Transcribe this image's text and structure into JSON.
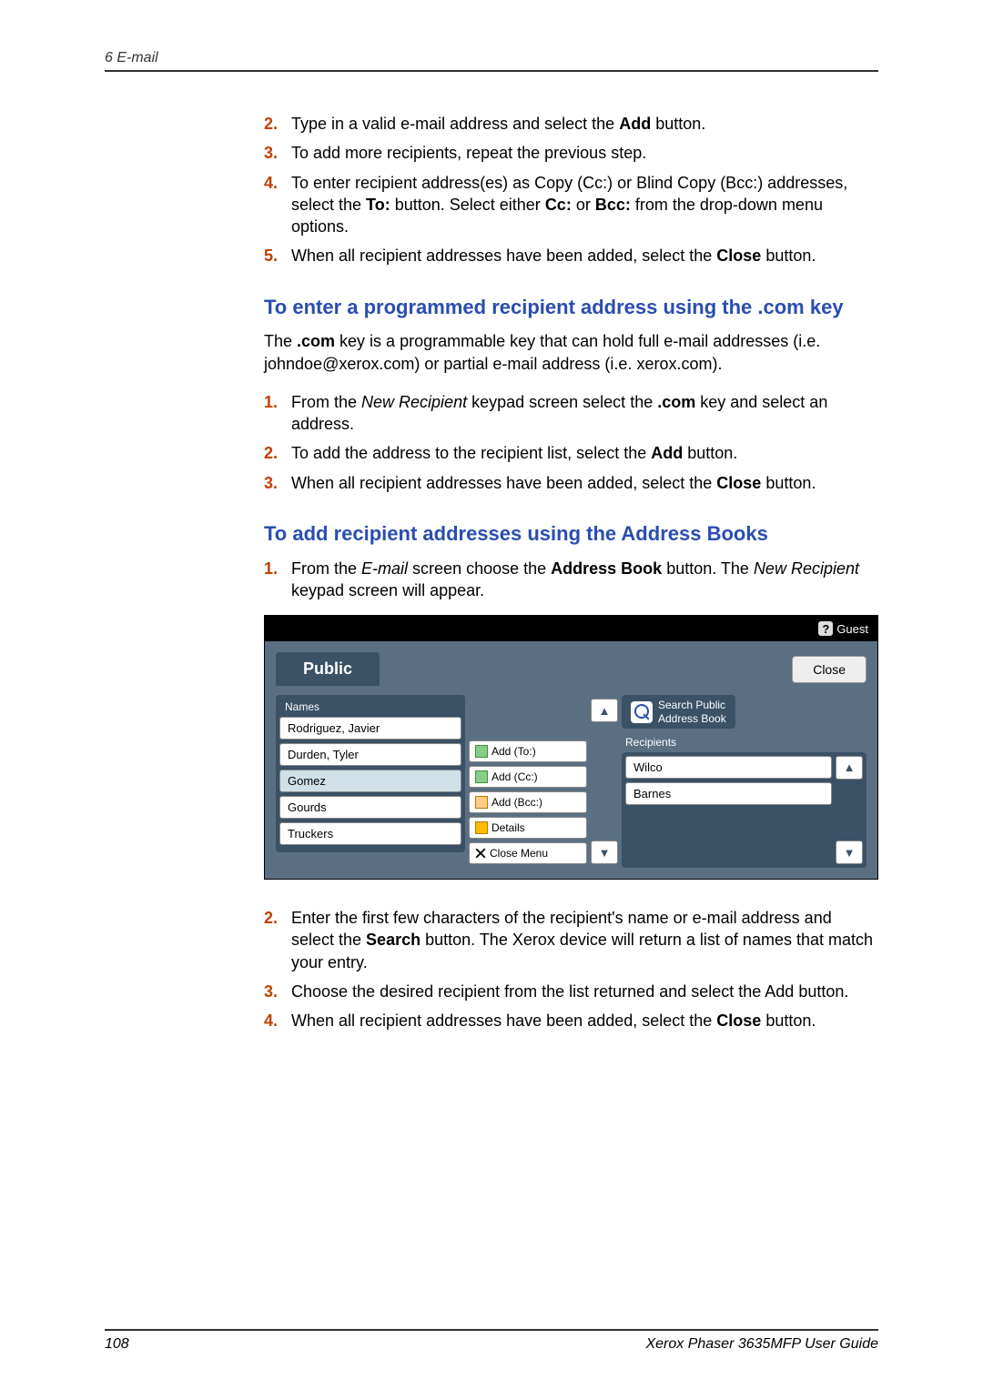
{
  "header": {
    "chapter": "6   E-mail"
  },
  "listA": {
    "n2": "2.",
    "t2a": "Type in a valid e-mail address and select the ",
    "t2b": "Add",
    "t2c": " button.",
    "n3": "3.",
    "t3": "To add more recipients, repeat the previous step.",
    "n4": "4.",
    "t4a": "To enter recipient address(es) as Copy (Cc:) or Blind Copy (Bcc:) addresses, select the ",
    "t4b": "To:",
    "t4c": " button. Select either ",
    "t4d": "Cc:",
    "t4e": " or ",
    "t4f": "Bcc:",
    "t4g": " from the drop-down menu options.",
    "n5": "5.",
    "t5a": "When all recipient addresses have been added, select the ",
    "t5b": "Close",
    "t5c": " button."
  },
  "h1": "To enter a programmed recipient address using the .com key",
  "p1": {
    "a": "The ",
    "b": ".com",
    "c": " key is a programmable key that can hold full e-mail addresses (i.e. johndoe@xerox.com) or partial e-mail address (i.e. xerox.com)."
  },
  "listB": {
    "n1": "1.",
    "t1a": "From the ",
    "t1b": "New Recipient",
    "t1c": " keypad screen select the ",
    "t1d": ".com",
    "t1e": " key and select an address.",
    "n2": "2.",
    "t2a": "To add the address to the recipient list, select the ",
    "t2b": "Add",
    "t2c": " button.",
    "n3": "3.",
    "t3a": "When all recipient addresses have been added, select the ",
    "t3b": "Close",
    "t3c": " button."
  },
  "h2": "To add recipient addresses using the Address Books",
  "listC": {
    "n1": "1.",
    "t1a": "From the ",
    "t1b": "E-mail",
    "t1c": " screen choose the ",
    "t1d": "Address Book",
    "t1e": " button. The ",
    "t1f": "New Recipient",
    "t1g": " keypad screen will appear."
  },
  "ss": {
    "guest": "Guest",
    "help_q": "?",
    "tab": "Public",
    "close": "Close",
    "names_title": "Names",
    "names": [
      "Rodriguez, Javier",
      "Durden, Tyler",
      "Gomez",
      "Gourds",
      "Truckers"
    ],
    "menu": {
      "to": "Add (To:)",
      "cc": "Add (Cc:)",
      "bcc": "Add (Bcc:)",
      "details": "Details",
      "close": "Close Menu"
    },
    "search_line1": "Search Public",
    "search_line2": "Address Book",
    "rec_title": "Recipients",
    "recipients": [
      "Wilco",
      "Barnes"
    ]
  },
  "listD": {
    "n2": "2.",
    "t2a": "Enter the first few characters of the recipient's name or e-mail address and select the ",
    "t2b": "Search",
    "t2c": " button. The Xerox device will return a list of names that match your entry.",
    "n3": "3.",
    "t3": "Choose the desired recipient from the list returned and select the Add button.",
    "n4": "4.",
    "t4a": "When all recipient addresses have been added, select the ",
    "t4b": "Close",
    "t4c": " button."
  },
  "footer": {
    "page": "108",
    "doc": "Xerox Phaser 3635MFP User Guide"
  }
}
